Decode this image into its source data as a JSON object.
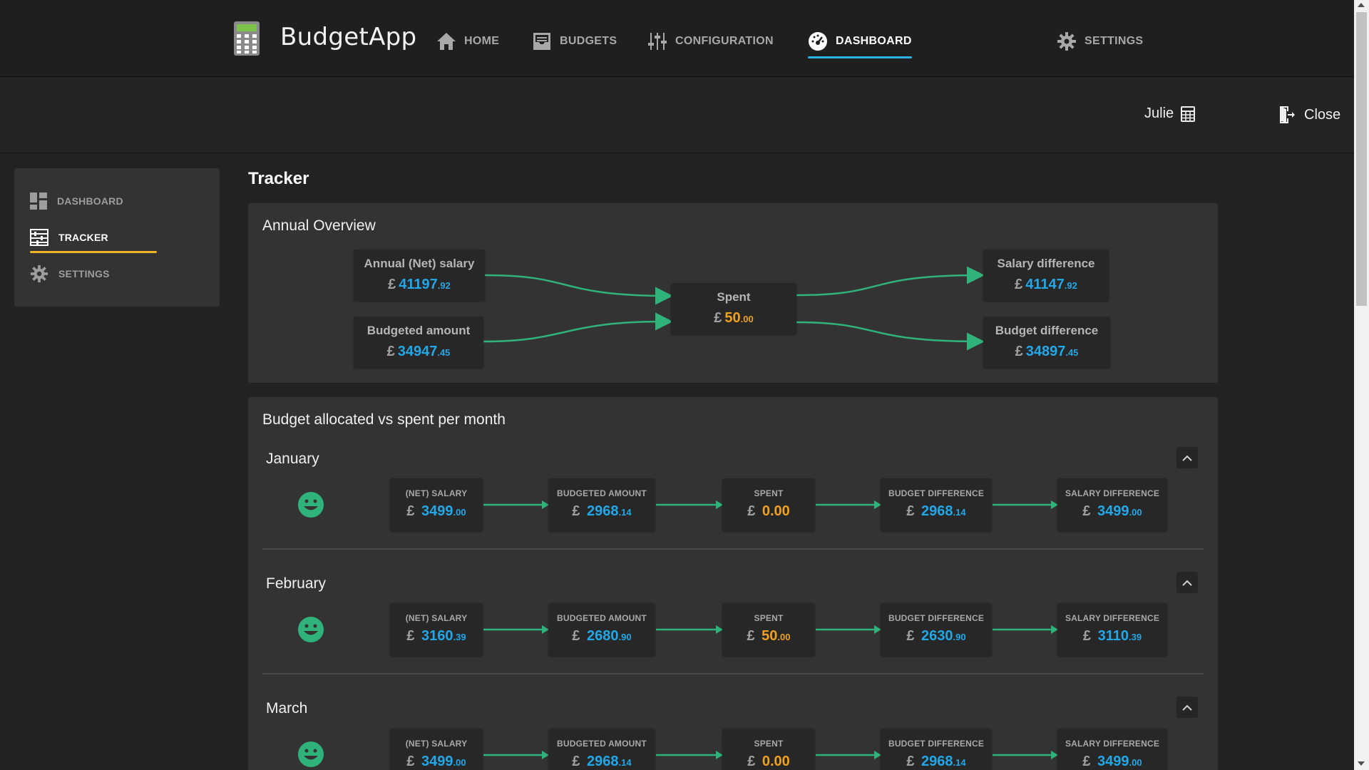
{
  "app": {
    "name": "BudgetApp"
  },
  "nav": {
    "home": "HOME",
    "budgets": "BUDGETS",
    "configuration": "CONFIGURATION",
    "dashboard": "DASHBOARD",
    "settings": "SETTINGS",
    "active": "DASHBOARD"
  },
  "user": {
    "name": "Julie",
    "close_label": "Close"
  },
  "sidebar": {
    "items": [
      {
        "label": "DASHBOARD",
        "icon": "dashboard-grid-icon"
      },
      {
        "label": "TRACKER",
        "icon": "tracker-icon",
        "active": true
      },
      {
        "label": "SETTINGS",
        "icon": "gear-icon"
      }
    ]
  },
  "page": {
    "title": "Tracker"
  },
  "overview": {
    "title": "Annual Overview",
    "currency": "£",
    "salary": {
      "label": "Annual (Net) salary",
      "whole": "41197",
      "dec": ".92"
    },
    "budgeted": {
      "label": "Budgeted amount",
      "whole": "34947",
      "dec": ".45"
    },
    "spent": {
      "label": "Spent",
      "whole": "50",
      "dec": ".00"
    },
    "salary_diff": {
      "label": "Salary difference",
      "whole": "41147",
      "dec": ".92"
    },
    "budget_diff": {
      "label": "Budget difference",
      "whole": "34897",
      "dec": ".45"
    }
  },
  "monthly": {
    "title": "Budget allocated vs spent per month",
    "labels": {
      "salary": "(NET) SALARY",
      "budgeted": "BUDGETED AMOUNT",
      "spent": "SPENT",
      "budget_diff": "BUDGET DIFFERENCE",
      "salary_diff": "SALARY DIFFERENCE"
    },
    "months": [
      {
        "name": "January",
        "status_icon": "smile-icon",
        "salary": {
          "whole": "3499",
          "dec": ".00"
        },
        "budgeted": {
          "whole": "2968",
          "dec": ".14"
        },
        "spent": {
          "whole": "0",
          "dec": ".00"
        },
        "budget_diff": {
          "whole": "2968",
          "dec": ".14"
        },
        "salary_diff": {
          "whole": "3499",
          "dec": ".00"
        }
      },
      {
        "name": "February",
        "status_icon": "smile-icon",
        "salary": {
          "whole": "3160",
          "dec": ".39"
        },
        "budgeted": {
          "whole": "2680",
          "dec": ".90"
        },
        "spent": {
          "whole": "50",
          "dec": ".00"
        },
        "budget_diff": {
          "whole": "2630",
          "dec": ".90"
        },
        "salary_diff": {
          "whole": "3110",
          "dec": ".39"
        }
      },
      {
        "name": "March",
        "status_icon": "smile-icon",
        "salary": {
          "whole": "3499",
          "dec": ".00"
        },
        "budgeted": {
          "whole": "2968",
          "dec": ".14"
        },
        "spent": {
          "whole": "0",
          "dec": ".00"
        },
        "budget_diff": {
          "whole": "2968",
          "dec": ".14"
        },
        "salary_diff": {
          "whole": "3499",
          "dec": ".00"
        }
      }
    ]
  },
  "colors": {
    "accent_blue": "#22a8e8",
    "accent_orange": "#f0a020",
    "flow_green": "#2fb37a",
    "tracker_underline": "#f0b429"
  }
}
